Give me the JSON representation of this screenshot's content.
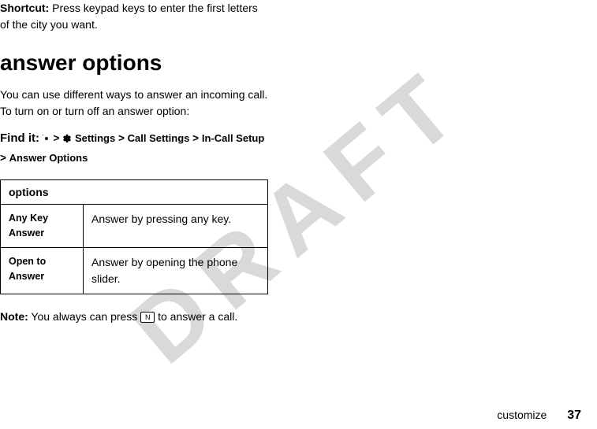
{
  "watermark": "DRAFT",
  "shortcut": {
    "label": "Shortcut:",
    "text1": " Press keypad keys to enter the first letters",
    "text2": "of the city you want."
  },
  "heading": "answer options",
  "intro": {
    "line1": "You can use different ways to answer an incoming call.",
    "line2": "To turn on or turn off an answer option:"
  },
  "findit": {
    "label": "Find it:",
    "sep": ">",
    "settings": "Settings",
    "call_settings": "Call Settings",
    "incall_setup": "In-Call Setup",
    "answer_options": "Answer Options"
  },
  "table": {
    "header": "options",
    "rows": [
      {
        "name": "Any Key Answer",
        "desc": "Answer by pressing any key."
      },
      {
        "name": "Open to Answer",
        "desc": "Answer by opening the phone slider."
      }
    ]
  },
  "note": {
    "label": "Note:",
    "before_key": " You always can press ",
    "key_glyph": "N",
    "after_key": " to answer a call."
  },
  "footer": {
    "section": "customize",
    "page": "37"
  }
}
